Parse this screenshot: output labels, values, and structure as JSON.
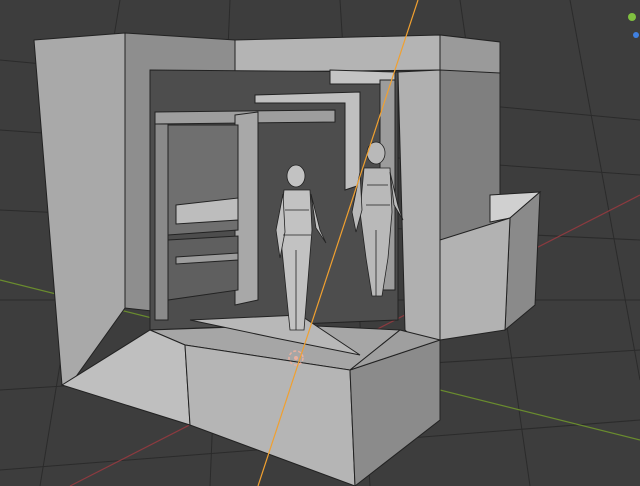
{
  "viewport": {
    "background": "#3d3d3d",
    "grid_color": "#2b2b2b",
    "x_axis_color": "#8c3a3f",
    "y_axis_color": "#6a8c2e",
    "z_axis_color": "#cf8a2a"
  },
  "scene": {
    "objects": [
      "wall-block",
      "doorway-frame",
      "inner-portal",
      "window-panel",
      "human-figure-front",
      "human-figure-back",
      "floor-platform",
      "side-bench"
    ],
    "geometry_color": "#b3b3b3",
    "edge_color": "#222222",
    "light_line_color": "#f0a030",
    "origin_marker_color": "#e8b0a0"
  },
  "gizmo": {
    "x_color": "#e04040",
    "y_color": "#80c040",
    "z_color": "#4080e0"
  }
}
